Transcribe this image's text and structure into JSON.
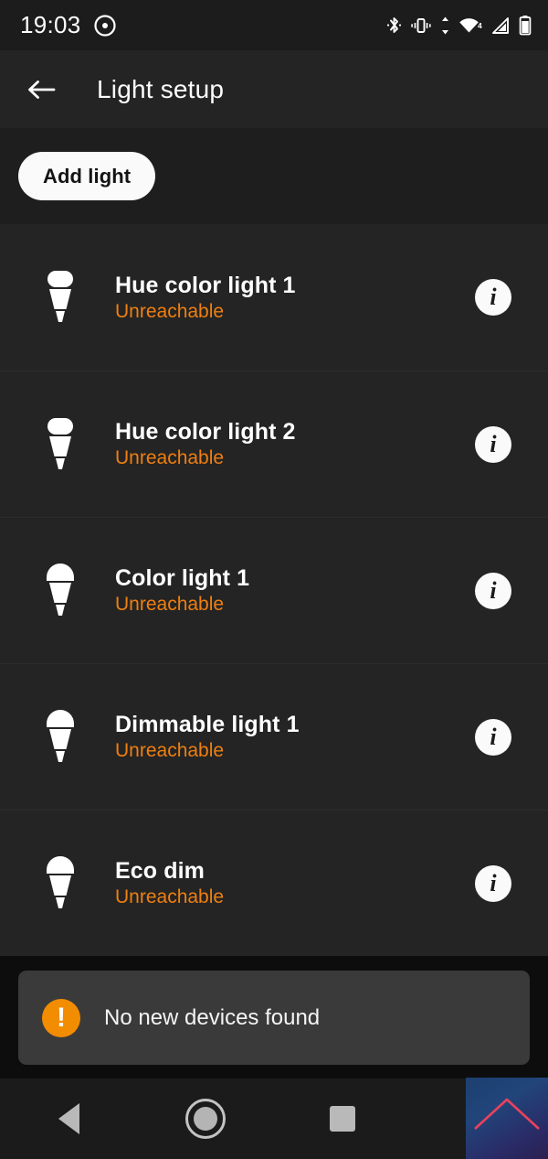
{
  "status_bar": {
    "time": "19:03",
    "icons_left": [
      "screen-record-icon"
    ],
    "icons_right": [
      "bluetooth-icon",
      "vibrate-icon",
      "data-transfer-icon",
      "wifi-icon",
      "cell-signal-icon",
      "battery-icon"
    ],
    "wifi_badge": "4"
  },
  "app_bar": {
    "back_icon": "back-arrow-icon",
    "title": "Light setup"
  },
  "toolbar": {
    "add_light_label": "Add light"
  },
  "lights": [
    {
      "name": "Hue color light 1",
      "status": "Unreachable",
      "icon": "candle-bulb-icon",
      "info_label": "i"
    },
    {
      "name": "Hue color light 2",
      "status": "Unreachable",
      "icon": "candle-bulb-icon",
      "info_label": "i"
    },
    {
      "name": "Color light 1",
      "status": "Unreachable",
      "icon": "round-bulb-icon",
      "info_label": "i"
    },
    {
      "name": "Dimmable light 1",
      "status": "Unreachable",
      "icon": "round-bulb-icon",
      "info_label": "i"
    },
    {
      "name": "Eco dim",
      "status": "Unreachable",
      "icon": "round-bulb-icon",
      "info_label": "i"
    }
  ],
  "snackbar": {
    "icon": "warning-exclamation-icon",
    "icon_glyph": "!",
    "message": "No new devices found"
  },
  "nav_bar": {
    "back": "back-triangle-icon",
    "home": "home-circle-icon",
    "recents": "recents-square-icon"
  },
  "overlay": {
    "name": "screen-recorder-thumbnail",
    "chevron": "chevron-up-icon"
  },
  "colors": {
    "accent_orange": "#ef7f10",
    "snackbar_orange": "#f28c00",
    "row_bg": "#242424",
    "page_bg": "#0d0d0d"
  }
}
